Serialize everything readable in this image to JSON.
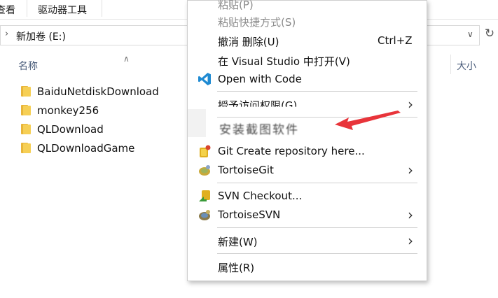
{
  "ribbon": {
    "tab_view": "查看",
    "tab_drive_tools": "驱动器工具"
  },
  "address_bar": {
    "path": "新加卷 (E:)"
  },
  "columns": {
    "name": "名称",
    "size": "大小"
  },
  "files": [
    {
      "name": "BaiduNetdiskDownload"
    },
    {
      "name": "monkey256"
    },
    {
      "name": "QLDownload"
    },
    {
      "name": "QLDownloadGame"
    }
  ],
  "context_menu": {
    "paste": "粘贴(P)",
    "paste_shortcut": "粘贴快捷方式(S)",
    "undo_delete": "撤消 删除(U)",
    "undo_delete_shortcut": "Ctrl+Z",
    "open_in_vs": "在 Visual Studio 中打开(V)",
    "open_with_code": "Open with Code",
    "grant_access": "授予访问权限(G)",
    "obscured_item": "安装截图软件",
    "git_create": "Git Create repository here...",
    "tortoise_git": "TortoiseGit",
    "svn_checkout": "SVN Checkout...",
    "tortoise_svn": "TortoiseSVN",
    "new": "新建(W)",
    "properties": "属性(R)"
  },
  "colors": {
    "annotation_arrow": "#e8343a",
    "vscode_blue": "#1f8ad2",
    "folder_yellow": "#f6cf55"
  }
}
